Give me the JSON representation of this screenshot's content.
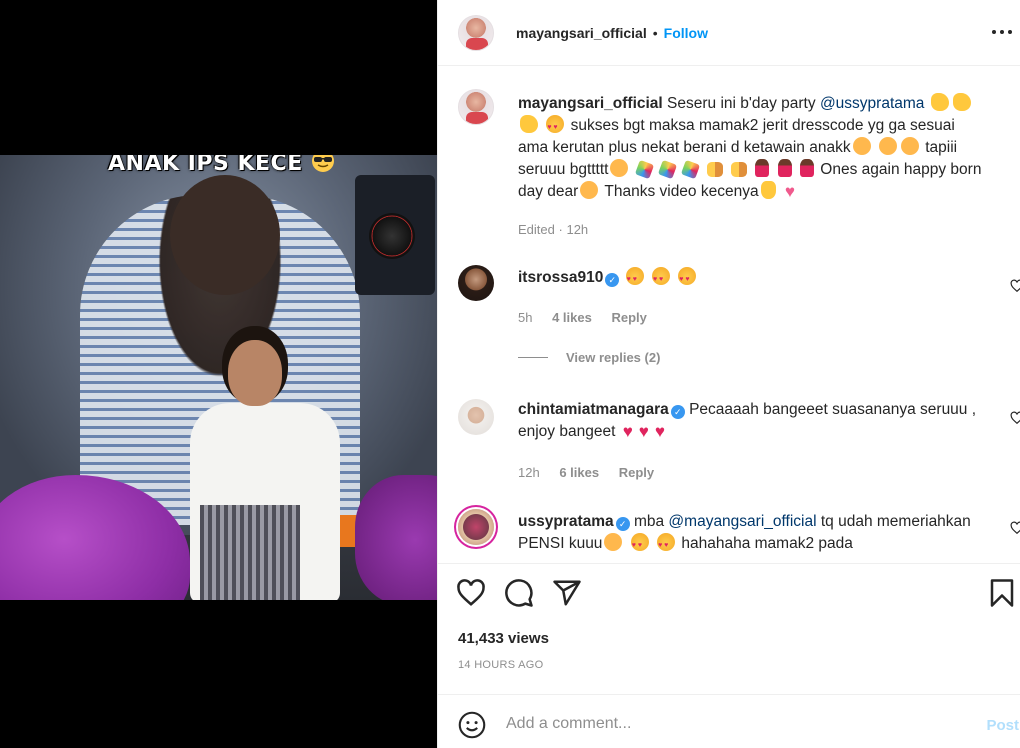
{
  "media": {
    "overlay_caption": "ANAK IPS KECE",
    "overlay_emoji": "sunglasses-emoji"
  },
  "header": {
    "username": "mayangsari_official",
    "separator": "•",
    "follow_label": "Follow",
    "more_label": "•••"
  },
  "caption": {
    "username": "mayangsari_official",
    "text_1": "Seseru ini b'day party",
    "mention": "@ussypratama",
    "text_2": "sukses bgt maksa mamak2 jerit dresscode yg ga sesuai ama kerutan plus nekat berani d ketawain anakk",
    "text_3": "tapiii seruuu bgttttt",
    "text_4": "Ones again happy born day dear",
    "text_5": "Thanks video kecenya",
    "edited": "Edited",
    "time": "12h"
  },
  "comments": [
    {
      "username": "itsrossa910",
      "verified": true,
      "time": "5h",
      "likes": "4 likes",
      "reply_label": "Reply"
    },
    {
      "username": "chintamiatmanagara",
      "verified": true,
      "text": "Pecaaaah bangeeet suasananya seruuu , enjoy bangeet",
      "time": "12h",
      "likes": "6 likes",
      "reply_label": "Reply"
    },
    {
      "username": "ussypratama",
      "verified": true,
      "text_1": "mba",
      "mention": "@mayangsari_official",
      "text_2": "tq udah memeriahkan PENSI kuuu",
      "text_3": "hahahaha mamak2 pada"
    }
  ],
  "view_replies": "View replies (2)",
  "stats": {
    "views": "41,433 views",
    "time_ago": "14 HOURS AGO"
  },
  "add_comment": {
    "placeholder": "Add a comment...",
    "post_label": "Post"
  },
  "colors": {
    "link_blue": "#0095f6",
    "mention_blue": "#00376b",
    "muted_gray": "#8e8e8e",
    "verified_blue": "#3897f0",
    "post_disabled": "#b2dffc"
  }
}
